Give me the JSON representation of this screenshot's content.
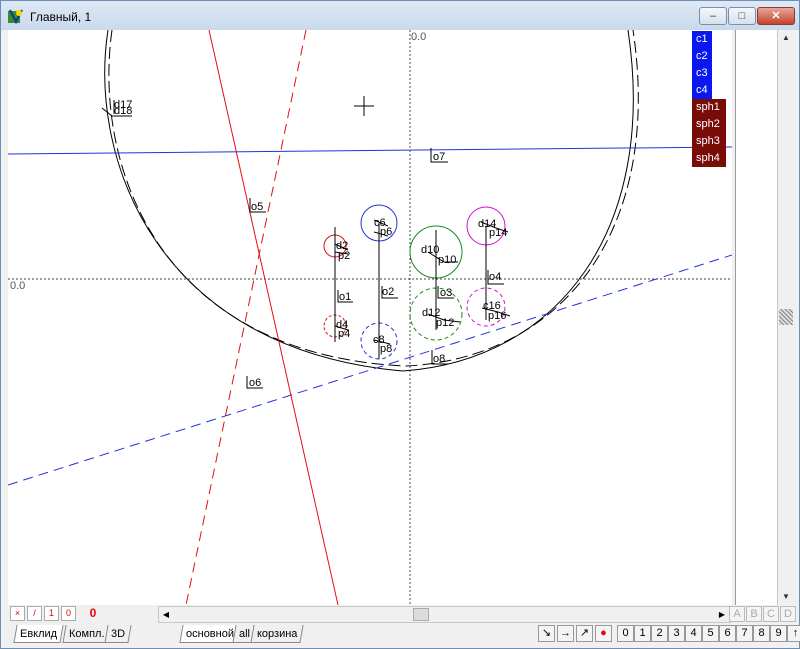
{
  "window": {
    "title": "Главный, 1",
    "controls": {
      "minimize": "–",
      "maximize": "□",
      "close": "✕"
    }
  },
  "canvas": {
    "axis_labels": {
      "top": "0.0",
      "left": "0.0"
    },
    "labels": [
      "d17",
      "d18",
      "o7",
      "o5",
      "c6",
      "p6",
      "d2",
      "p2",
      "d10",
      "p10",
      "d14",
      "p14",
      "o4",
      "o1",
      "o2",
      "o3",
      "d12",
      "p12",
      "c16",
      "p16",
      "d4",
      "p4",
      "c8",
      "p8",
      "o8",
      "o6"
    ]
  },
  "layers": [
    {
      "label": "c1",
      "color": "#0a18f0"
    },
    {
      "label": "c2",
      "color": "#0a18f0"
    },
    {
      "label": "c3",
      "color": "#0a18f0"
    },
    {
      "label": "c4",
      "color": "#0a18f0"
    },
    {
      "label": "sph1",
      "color": "#7a0c08"
    },
    {
      "label": "sph2",
      "color": "#7a0c08"
    },
    {
      "label": "sph3",
      "color": "#7a0c08"
    },
    {
      "label": "sph4",
      "color": "#7a0c08"
    }
  ],
  "toolbar": {
    "icons": [
      "x-icon",
      "slash-icon",
      "one-icon",
      "zero-icon"
    ],
    "icon_text": [
      "×",
      "/",
      "1",
      "0"
    ],
    "counter": "0"
  },
  "scroll_letters": [
    "A",
    "B",
    "C",
    "D"
  ],
  "tabs_left": [
    "Евклид",
    "Компл.",
    "3D"
  ],
  "tabs_right": [
    "основной",
    "all",
    "корзина"
  ],
  "right_buttons": {
    "tools": [
      "↘",
      "→",
      "↗",
      "●"
    ],
    "digits": [
      "0",
      "1",
      "2",
      "3",
      "4",
      "5",
      "6",
      "7",
      "8",
      "9",
      "↑"
    ]
  }
}
